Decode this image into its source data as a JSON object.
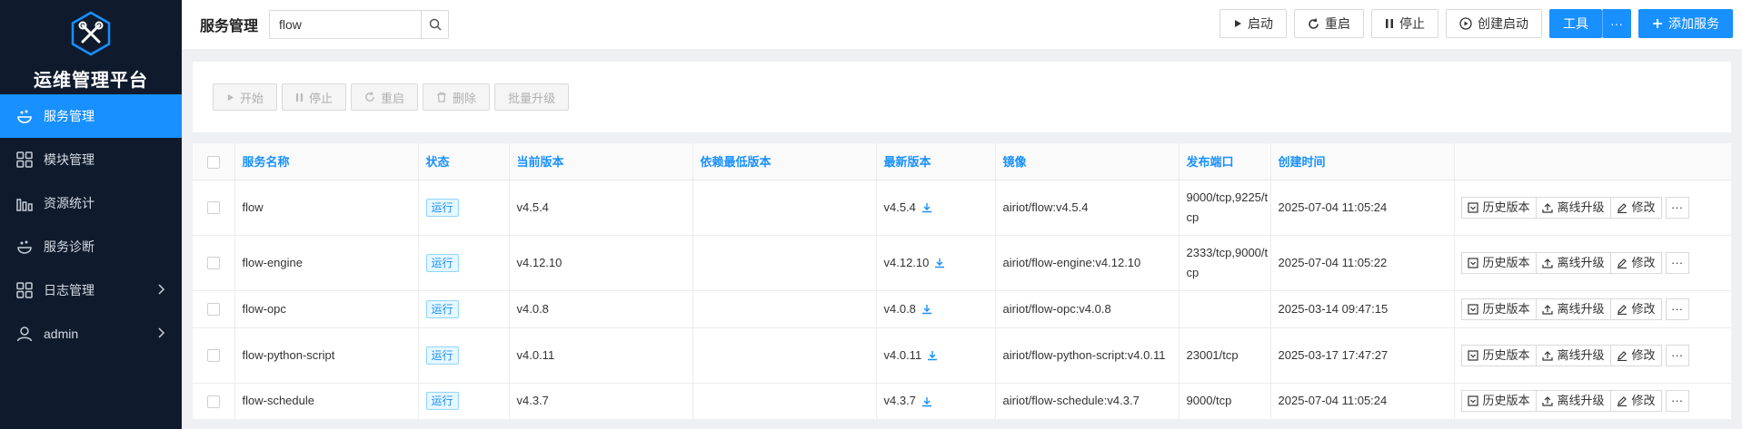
{
  "app": {
    "title": "运维管理平台"
  },
  "sidebar": {
    "items": [
      {
        "label": "服务管理",
        "icon": "service-icon",
        "active": true
      },
      {
        "label": "模块管理",
        "icon": "grid-icon"
      },
      {
        "label": "资源统计",
        "icon": "bar-chart-icon"
      },
      {
        "label": "服务诊断",
        "icon": "diagnose-icon"
      },
      {
        "label": "日志管理",
        "icon": "grid-icon",
        "expandable": true
      },
      {
        "label": "admin",
        "icon": "user-icon",
        "expandable": true
      }
    ]
  },
  "header": {
    "title": "服务管理",
    "search": {
      "value": "flow"
    },
    "buttons": {
      "start": "启动",
      "restart": "重启",
      "stop": "停止",
      "create_start": "创建启动",
      "tools": "工具",
      "more": "···",
      "add_service": "添加服务"
    }
  },
  "actionbar": {
    "start": "开始",
    "stop": "停止",
    "restart": "重启",
    "delete": "删除",
    "batch_upgrade": "批量升级"
  },
  "table": {
    "columns": [
      "服务名称",
      "状态",
      "当前版本",
      "依赖最低版本",
      "最新版本",
      "镜像",
      "发布端口",
      "创建时间"
    ],
    "rows": [
      {
        "name": "flow",
        "status": "运行",
        "current": "v4.5.4",
        "min_dep": "",
        "latest": "v4.5.4",
        "image": "airiot/flow:v4.5.4",
        "ports": "9000/tcp,9225/tcp",
        "created": "2025-07-04 11:05:24"
      },
      {
        "name": "flow-engine",
        "status": "运行",
        "current": "v4.12.10",
        "min_dep": "",
        "latest": "v4.12.10",
        "image": "airiot/flow-engine:v4.12.10",
        "ports": "2333/tcp,9000/tcp",
        "created": "2025-07-04 11:05:22"
      },
      {
        "name": "flow-opc",
        "status": "运行",
        "current": "v4.0.8",
        "min_dep": "",
        "latest": "v4.0.8",
        "image": "airiot/flow-opc:v4.0.8",
        "ports": "",
        "created": "2025-03-14 09:47:15"
      },
      {
        "name": "flow-python-script",
        "status": "运行",
        "current": "v4.0.11",
        "min_dep": "",
        "latest": "v4.0.11",
        "image": "airiot/flow-python-script:v4.0.11",
        "ports": "23001/tcp",
        "created": "2025-03-17 17:47:27"
      },
      {
        "name": "flow-schedule",
        "status": "运行",
        "current": "v4.3.7",
        "min_dep": "",
        "latest": "v4.3.7",
        "image": "airiot/flow-schedule:v4.3.7",
        "ports": "9000/tcp",
        "created": "2025-07-04 11:05:24"
      }
    ],
    "row_actions": {
      "history": "历史版本",
      "offline_upgrade": "离线升级",
      "edit": "修改",
      "more": "···"
    }
  },
  "colors": {
    "sidebar_bg": "#0f1b2d",
    "accent": "#1890ff"
  }
}
